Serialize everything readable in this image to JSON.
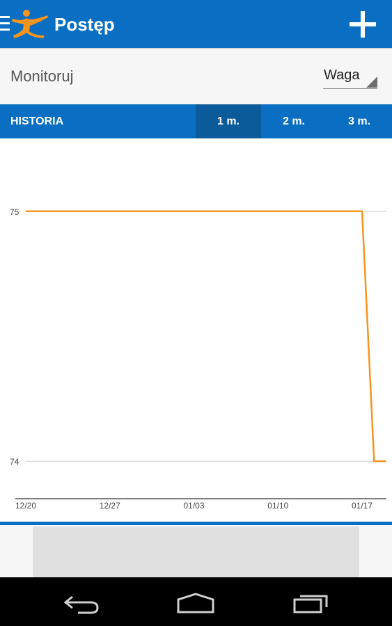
{
  "app": {
    "title": "Postęp",
    "menu_icon": "hamburger-menu-icon",
    "logo": "running-person-logo",
    "add_icon": "plus-icon",
    "accent_color": "#0a6fc2",
    "line_color": "#f7941d"
  },
  "monitor": {
    "label": "Monitoruj",
    "selected": "Waga"
  },
  "tabs": {
    "history": "HISTORIA",
    "items": [
      {
        "label": "1 m.",
        "active": true
      },
      {
        "label": "2 m.",
        "active": false
      },
      {
        "label": "3 m.",
        "active": false
      }
    ]
  },
  "chart_data": {
    "type": "line",
    "x": [
      "12/19",
      "12/20",
      "12/27",
      "01/03",
      "01/10",
      "01/17",
      "01/18",
      "01/19"
    ],
    "values": [
      75,
      75,
      75,
      75,
      75,
      75,
      74,
      74
    ],
    "x_ticks": [
      "12/20",
      "12/27",
      "01/03",
      "01/10",
      "01/17"
    ],
    "y_ticks": [
      75,
      74
    ],
    "ylim": [
      73.85,
      75.25
    ],
    "grid": true
  },
  "navbar": {
    "back_icon": "back-icon",
    "home_icon": "home-icon",
    "recents_icon": "recent-apps-icon"
  }
}
